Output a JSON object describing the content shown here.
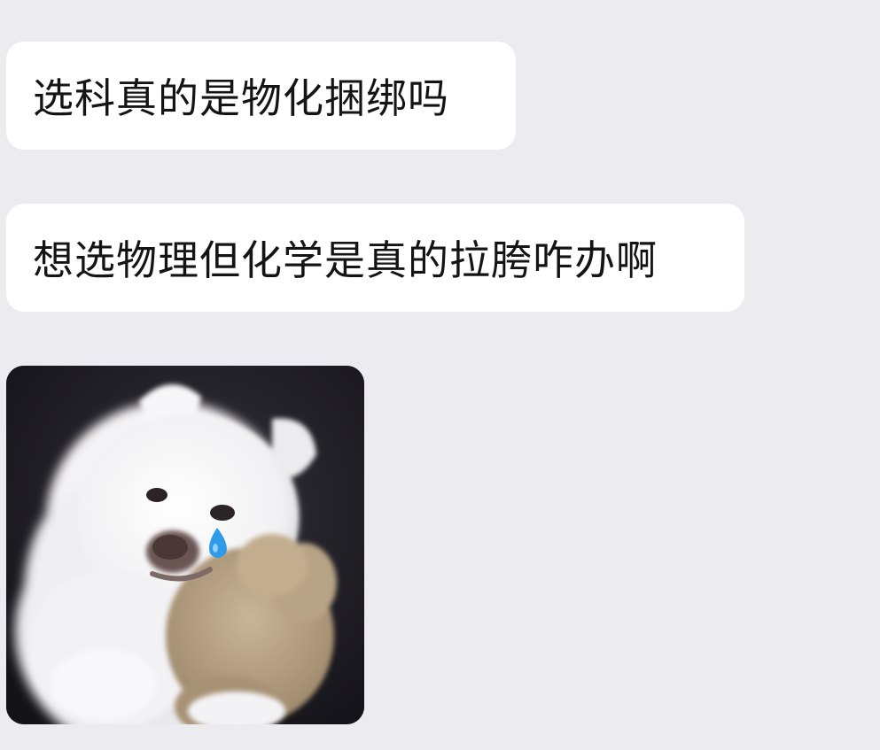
{
  "messages": [
    {
      "type": "text",
      "text": "选科真的是物化捆绑吗"
    },
    {
      "type": "text",
      "text": "想选物理但化学是真的拉胯咋办啊"
    },
    {
      "type": "sticker",
      "icon": "crying-puppy-hugging-teddy-bear-sticker"
    }
  ],
  "colors": {
    "background": "#ebebf0",
    "bubble": "#ffffff",
    "text": "#141414",
    "tear": "#2f9be8"
  }
}
